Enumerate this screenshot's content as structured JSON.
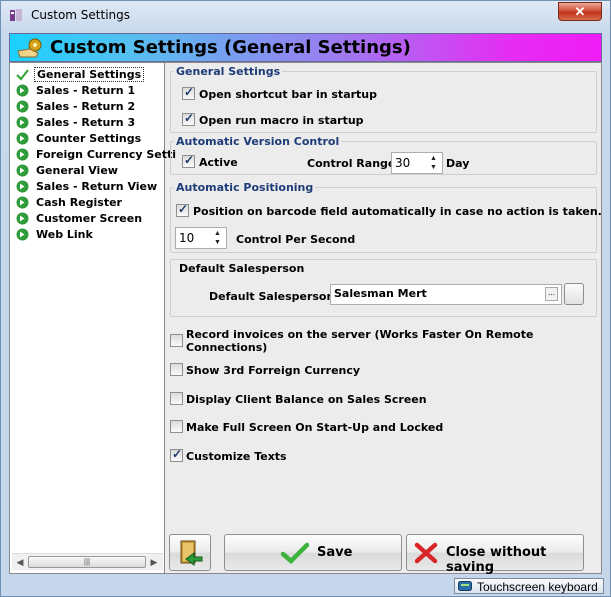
{
  "window": {
    "title": "Custom Settings",
    "close_label": "✕"
  },
  "header": {
    "title": "Custom Settings (General Settings)"
  },
  "sidebar": {
    "items": [
      {
        "label": "General Settings",
        "icon": "checkmark-icon",
        "selected": true
      },
      {
        "label": "Sales - Return 1",
        "icon": "green-arrow-icon"
      },
      {
        "label": "Sales - Return 2",
        "icon": "green-arrow-icon"
      },
      {
        "label": "Sales - Return 3",
        "icon": "green-arrow-icon"
      },
      {
        "label": "Counter Settings",
        "icon": "green-arrow-icon"
      },
      {
        "label": "Foreign Currency Setti",
        "icon": "green-arrow-icon"
      },
      {
        "label": "General View",
        "icon": "green-arrow-icon"
      },
      {
        "label": "Sales - Return View",
        "icon": "green-arrow-icon"
      },
      {
        "label": "Cash Register",
        "icon": "green-arrow-icon"
      },
      {
        "label": "Customer Screen",
        "icon": "green-arrow-icon"
      },
      {
        "label": "Web Link",
        "icon": "green-arrow-icon"
      }
    ],
    "scroll_thumb": "|||"
  },
  "general_settings": {
    "title": "General Settings",
    "open_shortcut_bar": {
      "label": "Open shortcut bar in startup",
      "checked": true
    },
    "open_run_macro": {
      "label": "Open run macro in startup",
      "checked": true
    }
  },
  "version_control": {
    "title": "Automatic Version Control",
    "active": {
      "label": "Active",
      "checked": true
    },
    "range_label": "Control Range",
    "range_value": "30",
    "range_unit": "Day"
  },
  "positioning": {
    "title": "Automatic Positioning",
    "barcode": {
      "label": "Position on barcode field automatically in case no action is taken.",
      "checked": true
    },
    "per_second_value": "10",
    "per_second_label": "Control Per Second"
  },
  "salesperson": {
    "title": "Default Salesperson",
    "label": "Default Salesperson",
    "value": "Salesman Mert",
    "dots": "..."
  },
  "options": {
    "record_invoices": {
      "label": "Record invoices on the server (Works Faster On Remote Connections)",
      "line1": "Record invoices on the server (Works Faster On Remote",
      "line2": "Connections)",
      "checked": false
    },
    "show_3rd_currency": {
      "label": "Show 3rd Forreign Currency",
      "checked": false
    },
    "display_client_balance": {
      "label": "Display Client Balance on Sales Screen",
      "checked": false
    },
    "full_screen": {
      "label": "Make Full Screen On Start-Up and Locked",
      "checked": false
    },
    "customize_texts": {
      "label": "Customize Texts",
      "checked": true
    }
  },
  "footer": {
    "save_label": "Save",
    "close_label": "Close without saving"
  },
  "statusbar": {
    "keyboard_label": "Touchscreen keyboard"
  },
  "colors": {
    "header_gradient_start": "#1bd1ff",
    "header_gradient_end": "#f01bf6",
    "group_title": "#1e3c78",
    "close_red": "#c2341a"
  }
}
